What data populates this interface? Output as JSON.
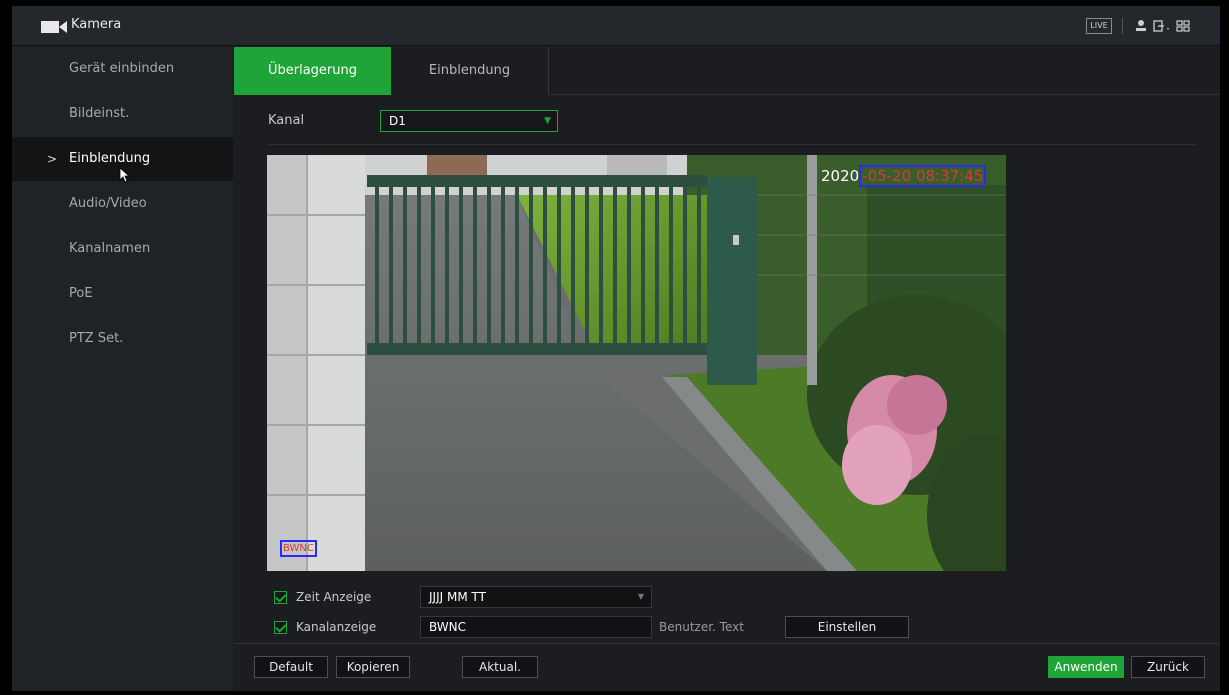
{
  "window": {
    "title": "Kamera",
    "live_badge": "LIVE"
  },
  "sidebar": {
    "items": [
      {
        "label": "Gerät einbinden"
      },
      {
        "label": "Bildeinst."
      },
      {
        "label": "Einblendung",
        "active": true
      },
      {
        "label": "Audio/Video"
      },
      {
        "label": "Kanalnamen"
      },
      {
        "label": "PoE"
      },
      {
        "label": "PTZ Set."
      }
    ],
    "active_chevron": ">"
  },
  "tabs": [
    {
      "label": "Überlagerung",
      "active": true
    },
    {
      "label": "Einblendung",
      "active": false
    }
  ],
  "channel": {
    "label": "Kanal",
    "value": "D1"
  },
  "video": {
    "osd_time_prefix": "2020",
    "osd_time_boxed": "-05-20 08:37:45",
    "osd_channel": "BWNC"
  },
  "options": {
    "time_display": {
      "label": "Zeit Anzeige",
      "checked": true,
      "format": "JJJJ MM TT"
    },
    "channel_display": {
      "label": "Kanalanzeige",
      "checked": true,
      "value": "BWNC",
      "custom_text_label": "Benutzer. Text",
      "set_button": "Einstellen"
    }
  },
  "footer": {
    "default": "Default",
    "copy": "Kopieren",
    "refresh": "Aktual.",
    "apply": "Anwenden",
    "back": "Zurück"
  },
  "colors": {
    "accent": "#1fa537",
    "background": "#1b1d21",
    "osd_box": "#2a2af0",
    "osd_text": "#d63a3a"
  }
}
